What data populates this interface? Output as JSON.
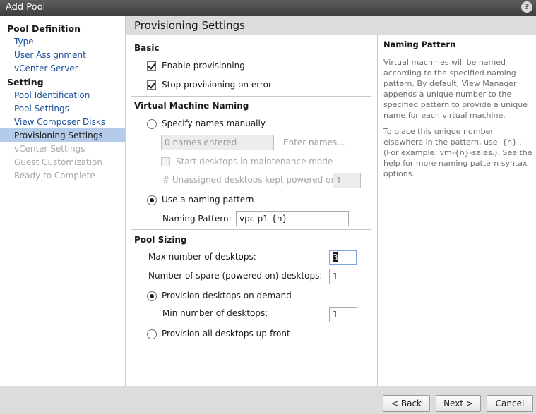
{
  "window": {
    "title": "Add Pool",
    "help_glyph": "?"
  },
  "nav": {
    "sections": [
      {
        "label": "Pool Definition",
        "items": [
          {
            "label": "Type",
            "state": "link"
          },
          {
            "label": "User Assignment",
            "state": "link"
          },
          {
            "label": "vCenter Server",
            "state": "link"
          }
        ]
      },
      {
        "label": "Setting",
        "items": [
          {
            "label": "Pool Identification",
            "state": "link"
          },
          {
            "label": "Pool Settings",
            "state": "link"
          },
          {
            "label": "View Composer Disks",
            "state": "link"
          },
          {
            "label": "Provisioning Settings",
            "state": "selected"
          },
          {
            "label": "vCenter Settings",
            "state": "disabled"
          },
          {
            "label": "Guest Customization",
            "state": "disabled"
          },
          {
            "label": "Ready to Complete",
            "state": "disabled"
          }
        ]
      }
    ]
  },
  "page": {
    "title": "Provisioning Settings"
  },
  "basic": {
    "heading": "Basic",
    "enable_provisioning": {
      "label": "Enable provisioning",
      "checked": true
    },
    "stop_on_error": {
      "label": "Stop provisioning on error",
      "checked": true
    }
  },
  "naming": {
    "heading": "Virtual Machine Naming",
    "manual": {
      "label": "Specify names manually",
      "selected": false,
      "names_entered": "0 names entered",
      "enter_names_placeholder": "Enter names...",
      "maintenance_label": "Start desktops in maintenance mode",
      "unassigned_label": "# Unassigned desktops kept powered on:",
      "unassigned_value": "1"
    },
    "pattern": {
      "label": "Use a naming pattern",
      "selected": true,
      "field_label": "Naming Pattern:",
      "value": "vpc-p1-{n}"
    }
  },
  "sizing": {
    "heading": "Pool Sizing",
    "max_label": "Max number of desktops:",
    "max_value": "3",
    "spare_label": "Number of spare (powered on) desktops:",
    "spare_value": "1",
    "on_demand": {
      "label": "Provision desktops on demand",
      "selected": true
    },
    "min_label": "Min number of desktops:",
    "min_value": "1",
    "up_front": {
      "label": "Provision all desktops up-front",
      "selected": false
    }
  },
  "help_panel": {
    "heading": "Naming Pattern",
    "para1": "Virtual machines will be named according to the specified naming pattern. By default, View Manager appends a unique number to the specified pattern to provide a unique name for each virtual machine.",
    "para2": "To place this unique number elsewhere in the pattern, use '{n}'. (For example: vm-{n}-sales.). See the help for more naming pattern syntax options."
  },
  "footer": {
    "back": "< Back",
    "next": "Next >",
    "cancel": "Cancel"
  },
  "colors": {
    "selection": "#b4cbea",
    "link": "#1a4e9a",
    "disabled": "#a8a8a8",
    "band": "#dcdcdc"
  }
}
